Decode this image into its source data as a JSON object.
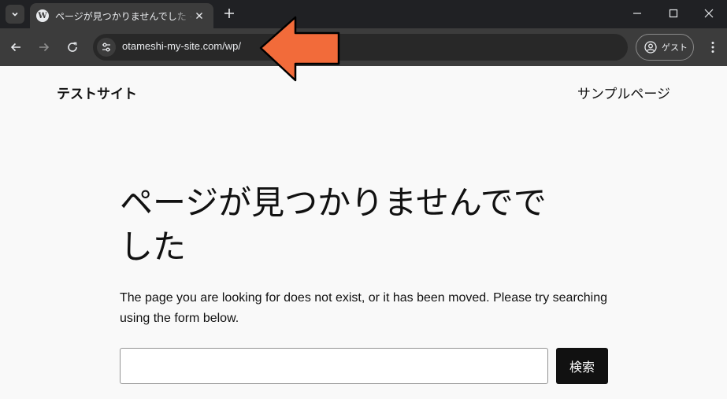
{
  "browser": {
    "tab": {
      "title": "ページが見つかりませんでした – テストサイト",
      "favicon_icon": "wordpress-icon"
    },
    "address_bar": {
      "url": "otameshi-my-site.com/wp/"
    },
    "profile": {
      "label": "ゲスト"
    },
    "icons": {
      "tab_search": "chevron-down-icon",
      "tab_close": "close-icon",
      "new_tab": "plus-icon",
      "minimize": "minimize-icon",
      "maximize": "maximize-icon",
      "close_window": "close-icon",
      "back": "arrow-left-icon",
      "forward": "arrow-right-icon",
      "reload": "reload-icon",
      "site_info": "tune-icon",
      "menu": "more-vert-icon"
    }
  },
  "page": {
    "site_title": "テストサイト",
    "nav_link": "サンプルページ",
    "heading_line1": "ページが見つかりませんでで",
    "heading_line2": "した",
    "description": "The page you are looking for does not exist, or it has been moved. Please try searching using the form below.",
    "search": {
      "value": "",
      "button_label": "検索"
    }
  },
  "annotation": {
    "arrow_color": "#f26b3a",
    "arrow_outline": "#000000"
  },
  "colors": {
    "tabbar_bg": "#202124",
    "toolbar_bg": "#3c3c3c",
    "page_bg": "#f9f9f9",
    "button_bg": "#111111"
  }
}
